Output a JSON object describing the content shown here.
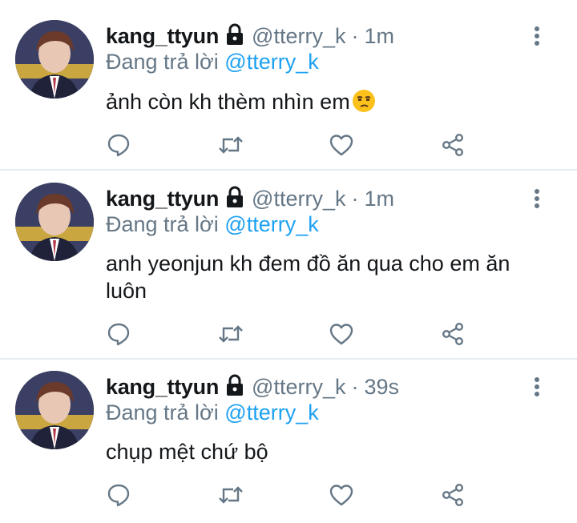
{
  "colors": {
    "link": "#1da1f2",
    "muted": "#657786",
    "text": "#14171a",
    "divider": "#e6ecf0"
  },
  "icons": {
    "lock": "lock-icon",
    "more": "more-vertical-icon",
    "reply": "reply-icon",
    "retweet": "retweet-icon",
    "like": "like-icon",
    "share": "share-icon"
  },
  "tweets": [
    {
      "name": "kang_ttyun",
      "handle": "@tterry_k",
      "separator": "·",
      "time": "1m",
      "reply_prefix": "Đang trả lời",
      "reply_to": "@tterry_k",
      "text": "ảnh còn kh thèm nhìn em",
      "emoji": "unamused-face"
    },
    {
      "name": "kang_ttyun",
      "handle": "@tterry_k",
      "separator": "·",
      "time": "1m",
      "reply_prefix": "Đang trả lời",
      "reply_to": "@tterry_k",
      "text": "anh yeonjun kh đem đồ ăn qua cho em ăn luôn"
    },
    {
      "name": "kang_ttyun",
      "handle": "@tterry_k",
      "separator": "·",
      "time": "39s",
      "reply_prefix": "Đang trả lời",
      "reply_to": "@tterry_k",
      "text": "chụp mệt chứ bộ"
    }
  ]
}
